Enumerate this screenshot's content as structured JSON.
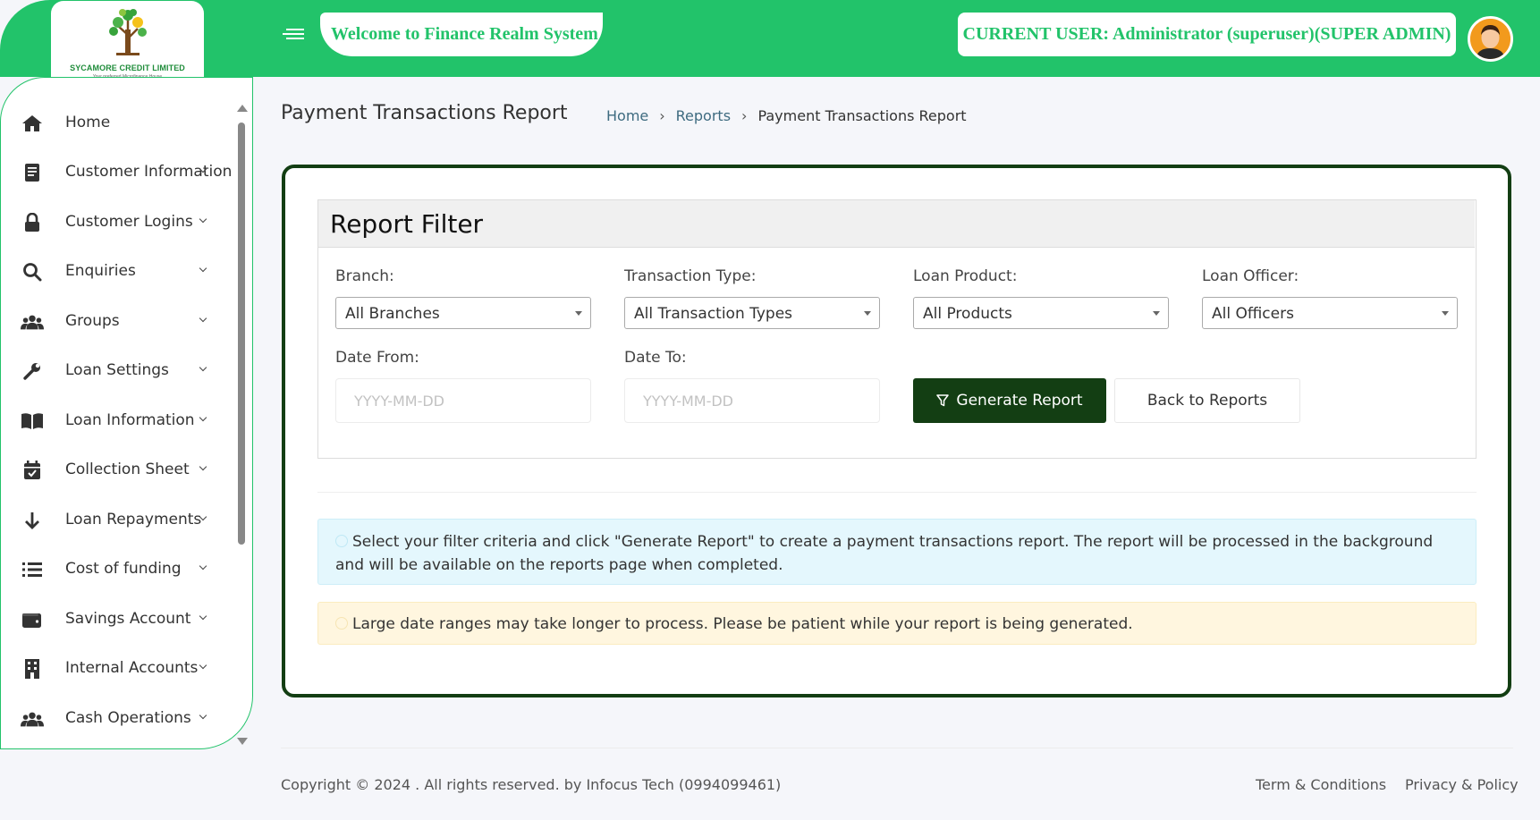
{
  "app": {
    "welcome": "Welcome to Finance Realm System",
    "current_user": "CURRENT USER: Administrator (superuser)(SUPER ADMIN)",
    "logo": {
      "name": "SYCAMORE CREDIT LIMITED",
      "tagline": "Your preferred Microfinance House"
    }
  },
  "icons": {
    "menu": "hamburger-icon",
    "avatar": "user-avatar-icon"
  },
  "colors": {
    "brand_green": "#22c36a",
    "dark_green": "#133e13",
    "info_bg": "#e4f7fd",
    "warn_bg": "#fff6df"
  },
  "sidebar": {
    "items": [
      {
        "label": "Home",
        "icon": "home-icon",
        "has_chevron": false
      },
      {
        "label": "Customer Information",
        "icon": "address-book-icon",
        "has_chevron": true
      },
      {
        "label": "Customer Logins",
        "icon": "lock-icon",
        "has_chevron": true
      },
      {
        "label": "Enquiries",
        "icon": "search-icon",
        "has_chevron": true
      },
      {
        "label": "Groups",
        "icon": "users-icon",
        "has_chevron": true
      },
      {
        "label": "Loan Settings",
        "icon": "wrench-icon",
        "has_chevron": true
      },
      {
        "label": "Loan Information",
        "icon": "book-icon",
        "has_chevron": true
      },
      {
        "label": "Collection Sheet",
        "icon": "calendar-check-icon",
        "has_chevron": true
      },
      {
        "label": "Loan Repayments",
        "icon": "arrow-down-icon",
        "has_chevron": true
      },
      {
        "label": "Cost of funding",
        "icon": "list-icon",
        "has_chevron": true
      },
      {
        "label": "Savings Account",
        "icon": "wallet-icon",
        "has_chevron": true
      },
      {
        "label": "Internal Accounts",
        "icon": "building-icon",
        "has_chevron": true
      },
      {
        "label": "Cash Operations",
        "icon": "users-icon",
        "has_chevron": true
      }
    ]
  },
  "page": {
    "title": "Payment Transactions Report",
    "breadcrumb": [
      "Home",
      "Reports",
      "Payment Transactions Report"
    ]
  },
  "filter": {
    "title": "Report Filter",
    "branch": {
      "label": "Branch:",
      "value": "All Branches"
    },
    "transaction_type": {
      "label": "Transaction Type:",
      "value": "All Transaction Types"
    },
    "loan_product": {
      "label": "Loan Product:",
      "value": "All Products"
    },
    "loan_officer": {
      "label": "Loan Officer:",
      "value": "All Officers"
    },
    "date_from": {
      "label": "Date From:",
      "placeholder": "YYYY-MM-DD"
    },
    "date_to": {
      "label": "Date To:",
      "placeholder": "YYYY-MM-DD"
    },
    "generate_label": "Generate Report",
    "back_label": "Back to Reports"
  },
  "alerts": {
    "info": "Select your filter criteria and click \"Generate Report\" to create a payment transactions report. The report will be processed in the background and will be available on the reports page when completed.",
    "warning": "Large date ranges may take longer to process. Please be patient while your report is being generated."
  },
  "footer": {
    "copyright": "Copyright © 2024 . All rights reserved. by Infocus Tech (0994099461)",
    "terms": "Term & Conditions",
    "privacy": "Privacy & Policy"
  }
}
